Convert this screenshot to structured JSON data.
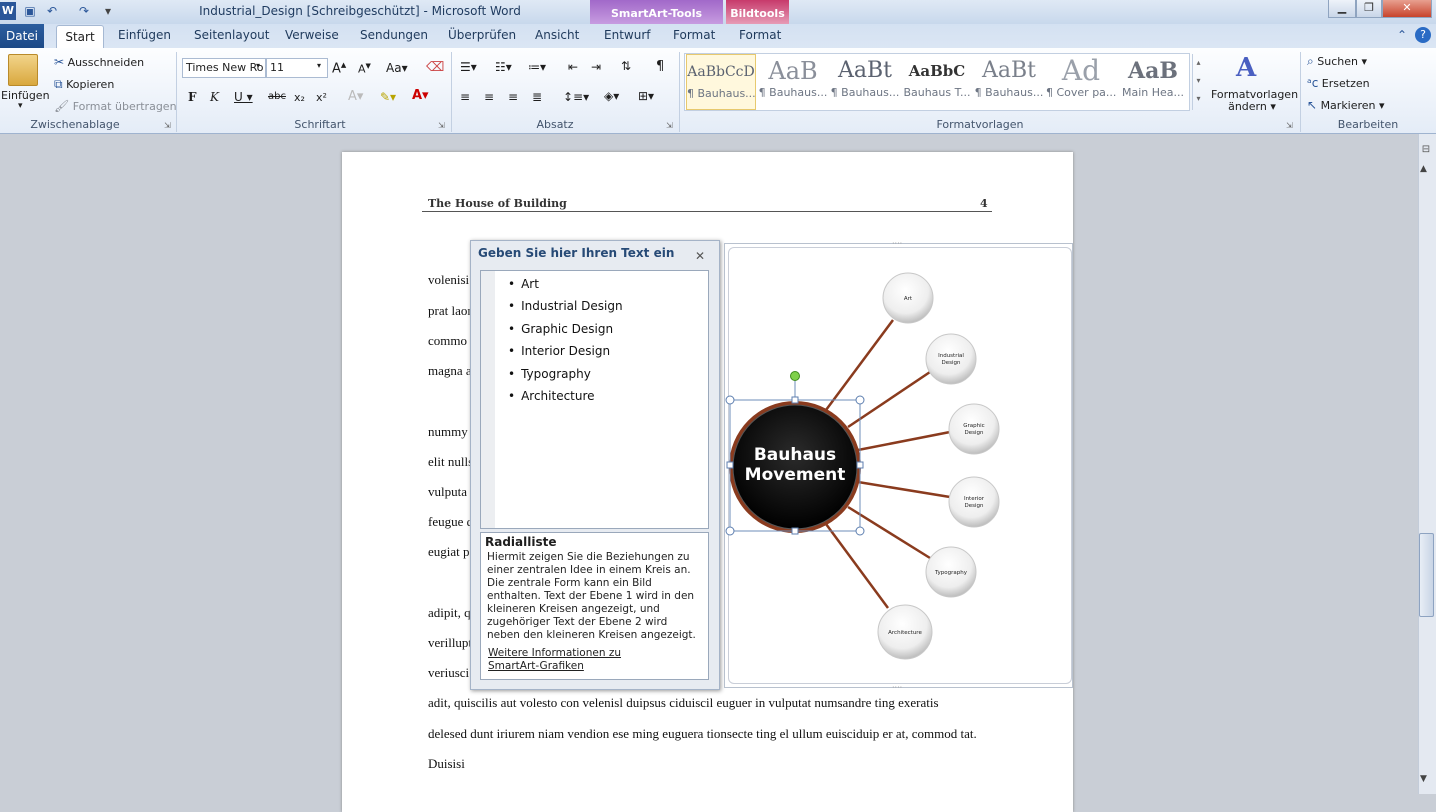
{
  "window": {
    "title": "Industrial_Design [Schreibgeschützt] - Microsoft Word",
    "context_smartart": "SmartArt-Tools",
    "context_bild": "Bildtools"
  },
  "tabs": [
    "Datei",
    "Start",
    "Einfügen",
    "Seitenlayout",
    "Verweise",
    "Sendungen",
    "Überprüfen",
    "Ansicht",
    "Entwurf",
    "Format",
    "Format"
  ],
  "ribbon": {
    "clipboard": {
      "paste": "Einfügen",
      "cut": "Ausschneiden",
      "copy": "Kopieren",
      "format_painter": "Format übertragen",
      "label": "Zwischenablage"
    },
    "font": {
      "name": "Times New Ro",
      "size": "11",
      "label": "Schriftart"
    },
    "paragraph": {
      "label": "Absatz"
    },
    "styles": {
      "label": "Formatvorlagen",
      "change": "Formatvorlagen",
      "change2": "ändern",
      "items": [
        {
          "preview": "AaBbCcD",
          "name": "¶ Bauhaus..."
        },
        {
          "preview": "AaB",
          "name": "¶ Bauhaus..."
        },
        {
          "preview": "AaBt",
          "name": "¶ Bauhaus..."
        },
        {
          "preview": "AaBbC",
          "name": "Bauhaus T..."
        },
        {
          "preview": "AaBt",
          "name": "¶ Bauhaus..."
        },
        {
          "preview": "Ad",
          "name": "¶ Cover pa..."
        },
        {
          "preview": "AaB",
          "name": "Main Hea..."
        }
      ]
    },
    "editing": {
      "find": "Suchen",
      "replace": "Ersetzen",
      "select": "Markieren",
      "label": "Bearbeiten"
    }
  },
  "document": {
    "header_title": "The House of Building",
    "header_page": "4",
    "lines": [
      "volenisi",
      "prat laor",
      "commo",
      "magna a",
      "nummy",
      "elit nulls",
      "vulputa",
      "feugue d",
      "eugiat p",
      "adipit, q",
      "verillupt",
      "veriusci",
      "adit, quiscilis  aut volesto con velenisl  duipsus  ciduiscil  euguer in  vulputat numsandre ting exeratis",
      "delesed dunt iriurem niam vendion ese ming euguera tionsecte ting el ullum euisciduip  er at, commod tat.",
      "Duisisi"
    ]
  },
  "text_pane": {
    "title": "Geben Sie hier Ihren Text ein",
    "items": [
      "Art",
      "Industrial Design",
      "Graphic Design",
      "Interior Design",
      "Typography",
      "Architecture"
    ],
    "layout_name": "Radialliste",
    "layout_desc": "Hiermit zeigen Sie die Beziehungen zu einer zentralen Idee in einem Kreis an. Die zentrale Form kann ein Bild enthalten. Text der Ebene 1 wird in den kleineren Kreisen angezeigt, und zugehöriger Text der Ebene 2 wird neben den kleineren Kreisen angezeigt.",
    "more_info": "Weitere Informationen zu SmartArt-Grafiken"
  },
  "smartart": {
    "center_line1": "Bauhaus",
    "center_line2": "Movement",
    "nodes": [
      [
        "Art"
      ],
      [
        "Industrial",
        "Design"
      ],
      [
        "Graphic",
        "Design"
      ],
      [
        "Interior",
        "Design"
      ],
      [
        "Typography"
      ],
      [
        "Architecture"
      ]
    ]
  }
}
